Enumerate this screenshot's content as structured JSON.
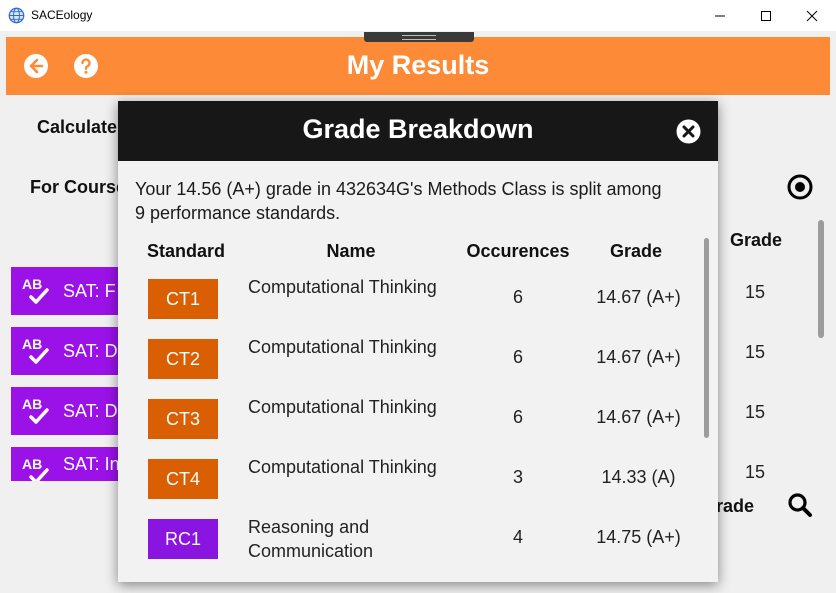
{
  "window": {
    "title": "SACEology"
  },
  "header": {
    "title": "My Results"
  },
  "background": {
    "calculate_label": "Calculate",
    "for_course_label": "For Course",
    "grade_column": "Grade",
    "grade_column_partial": "rade",
    "sat_items": [
      {
        "label": "SAT: F",
        "grade": "15"
      },
      {
        "label": "SAT: D",
        "grade": "15"
      },
      {
        "label": "SAT: D",
        "grade": "15"
      },
      {
        "label": "SAT: In",
        "grade": "15"
      }
    ]
  },
  "modal": {
    "title": "Grade Breakdown",
    "description": "Your 14.56 (A+) grade in 432634G's Methods Class is split among 9 performance standards.",
    "columns": {
      "standard": "Standard",
      "name": "Name",
      "occurences": "Occurences",
      "grade": "Grade"
    },
    "rows": [
      {
        "code": "CT1",
        "name": "Computational Thinking",
        "occurences": "6",
        "grade": "14.67 (A+)",
        "color": "#d95f02"
      },
      {
        "code": "CT2",
        "name": "Computational Thinking",
        "occurences": "6",
        "grade": "14.67 (A+)",
        "color": "#d95f02"
      },
      {
        "code": "CT3",
        "name": "Computational Thinking",
        "occurences": "6",
        "grade": "14.67 (A+)",
        "color": "#d95f02"
      },
      {
        "code": "CT4",
        "name": "Computational Thinking",
        "occurences": "3",
        "grade": "14.33 (A)",
        "color": "#d95f02"
      },
      {
        "code": "RC1",
        "name": "Reasoning and Communication",
        "occurences": "4",
        "grade": "14.75 (A+)",
        "color": "#8a14e0"
      }
    ]
  },
  "colors": {
    "header": "#fc8a36",
    "modal_header": "#171717",
    "sat_button": "#9a12e8"
  },
  "icons": [
    "app-globe-icon",
    "back-arrow-icon",
    "help-icon",
    "target-icon",
    "search-icon",
    "close-icon",
    "ab-check-icon"
  ]
}
